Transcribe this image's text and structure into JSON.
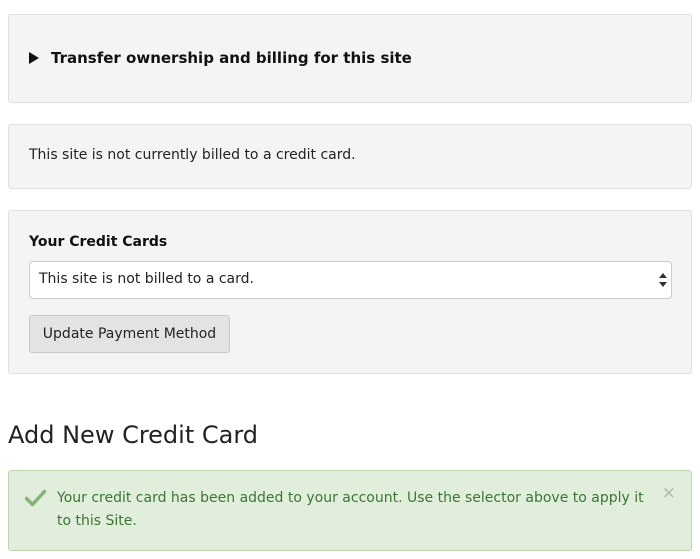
{
  "transfer_panel": {
    "label": "Transfer ownership and billing for this site"
  },
  "status_panel": {
    "text": "This site is not currently billed to a credit card."
  },
  "cards_panel": {
    "heading": "Your Credit Cards",
    "select_value": "This site is not billed to a card.",
    "update_button_label": "Update Payment Method"
  },
  "add_card": {
    "heading": "Add New Credit Card"
  },
  "alert": {
    "message": "Your credit card has been added to your account. Use the selector above to apply it to this Site.",
    "close_symbol": "×"
  },
  "icons": {
    "transfer_toggle": "caret-right-icon",
    "select_arrows": "up-down-arrows-icon",
    "success": "check-icon",
    "dismiss": "close-icon"
  },
  "colors": {
    "panel_background": "#f4f4f4",
    "alert_background": "#e0eedb",
    "alert_text": "#3b7634",
    "check": "#86b279"
  }
}
